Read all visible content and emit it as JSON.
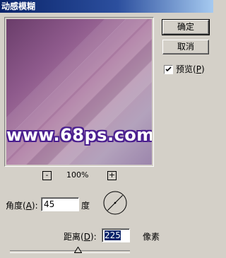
{
  "window": {
    "title": "动感模糊"
  },
  "buttons": {
    "ok_label": "确定",
    "cancel_label": "取消"
  },
  "preview_option": {
    "label_prefix": "预览(",
    "label_hotkey": "P",
    "label_suffix": ")",
    "checked": true
  },
  "preview": {
    "watermark_text": "www.68ps.com"
  },
  "zoom": {
    "minus_label": "-",
    "value": "100%",
    "plus_label": "+"
  },
  "angle": {
    "label_prefix": "角度(",
    "label_hotkey": "A",
    "label_suffix": "):",
    "value": "45",
    "unit": "度",
    "dial_degrees": 45
  },
  "distance": {
    "label_prefix": "距离(",
    "label_hotkey": "D",
    "label_suffix": "):",
    "value": "225",
    "unit": "像素",
    "slider_fraction": 0.57
  },
  "colors": {
    "title_bar_start": "#0a246a",
    "selection": "#0a246a",
    "watermark_outline": "#4b1f8f"
  },
  "icons": {
    "check": "check-icon",
    "dial": "angle-dial-icon",
    "slider_thumb": "slider-thumb-icon"
  }
}
